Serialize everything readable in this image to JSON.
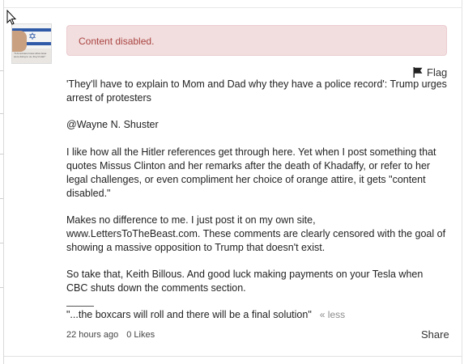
{
  "alert": {
    "text": "Content disabled."
  },
  "flag": {
    "label": "Flag",
    "icon": "flag-icon"
  },
  "comment": {
    "paragraphs": [
      "'They'll have to explain to Mom and Dad why they have a police record': Trump urges arrest of protesters",
      "@Wayne N. Shuster",
      "I like how all the Hitler references get through here. Yet when I post something that quotes Missus Clinton and her remarks after the death of Khadaffy, or refer to her legal challenges, or even compliment her choice of orange attire, it gets \"content disabled.\"",
      "Makes no difference to me. I just post it on my own site, www.LettersToTheBeast.com. These comments are clearly censored with the goal of showing a massive opposition to Trump that doesn't exist.",
      "So take that, Keith Billous. And good luck making payments on your Tesla when CBC shuts down the comments section."
    ],
    "signature": "\"...the boxcars will roll and there will be a final solution\"",
    "less_link": "« less"
  },
  "meta": {
    "timestamp": "22 hours ago",
    "likes": "0 Likes",
    "share_label": "Share"
  },
  "avatar": {
    "caption": "\"If Americans knew what Jews were doing to us, they'd start\""
  },
  "colors": {
    "alert_bg": "#f2dede",
    "alert_text": "#a94442",
    "alert_border": "#ebccd1"
  }
}
